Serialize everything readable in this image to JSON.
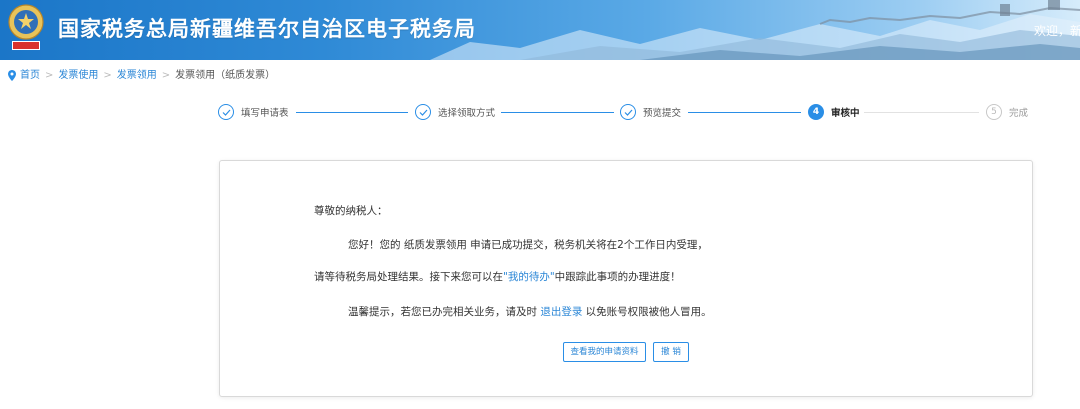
{
  "header": {
    "title": "国家税务总局新疆维吾尔自治区电子税务局",
    "welcome": "欢迎，新"
  },
  "breadcrumb": [
    {
      "label": "首页",
      "link": true
    },
    {
      "label": "发票使用",
      "link": true
    },
    {
      "label": "发票领用",
      "link": true
    },
    {
      "label": "发票领用（纸质发票）",
      "link": false
    }
  ],
  "steps": [
    {
      "label": "填写申请表",
      "status": "done"
    },
    {
      "label": "选择领取方式",
      "status": "done"
    },
    {
      "label": "预览提交",
      "status": "done"
    },
    {
      "number": "4",
      "label": "审核中",
      "status": "active"
    },
    {
      "number": "5",
      "label": "完成",
      "status": "pending"
    }
  ],
  "message": {
    "greeting": "尊敬的纳税人：",
    "line1": "您好！您的 纸质发票领用 申请已成功提交，税务机关将在2个工作日内受理，",
    "line2_prefix": "请等待税务局处理结果。接下来您可以在",
    "line2_link": "\"我的待办\"",
    "line2_suffix": "中跟踪此事项的办理进度！",
    "tip_prefix": "温馨提示，若您已办完相关业务，请及时 ",
    "tip_link": "退出登录",
    "tip_suffix": " 以免账号权限被他人冒用。"
  },
  "buttons": {
    "view_application": "查看我的申请资料",
    "cancel": "撤 销"
  },
  "colors": {
    "accent": "#2a8ee6",
    "link": "#2a86d6",
    "header_start": "#1b76c8"
  }
}
